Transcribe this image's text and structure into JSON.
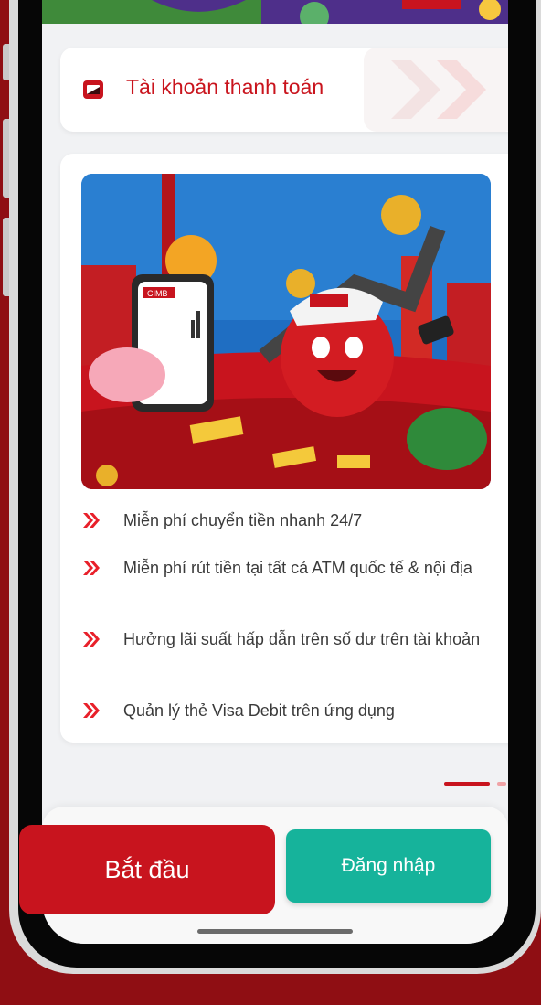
{
  "colors": {
    "brand_red": "#c8141e",
    "background": "#8f0e13",
    "teal": "#16b39b",
    "screen_bg": "#f1f2f4"
  },
  "tab": {
    "icon": "card-icon",
    "label": "Tài khoản thanh toán"
  },
  "promo": {
    "image": {
      "logo_text": "CIMB"
    },
    "features": [
      {
        "icon": "double-chevron-right-icon",
        "text": "Miễn phí chuyển tiền nhanh 24/7"
      },
      {
        "icon": "double-chevron-right-icon",
        "text": "Miễn phí rút tiền tại tất cả ATM quốc tế & nội địa"
      },
      {
        "icon": "double-chevron-right-icon",
        "text": "Hưởng lãi suất hấp dẫn trên số dư trên tài khoản"
      },
      {
        "icon": "double-chevron-right-icon",
        "text": "Quản lý thẻ Visa Debit trên ứng dụng"
      }
    ]
  },
  "pager": {
    "current": 1,
    "total": 2
  },
  "actions": {
    "start_label": "Bắt đầu",
    "login_label": "Đăng nhập"
  }
}
